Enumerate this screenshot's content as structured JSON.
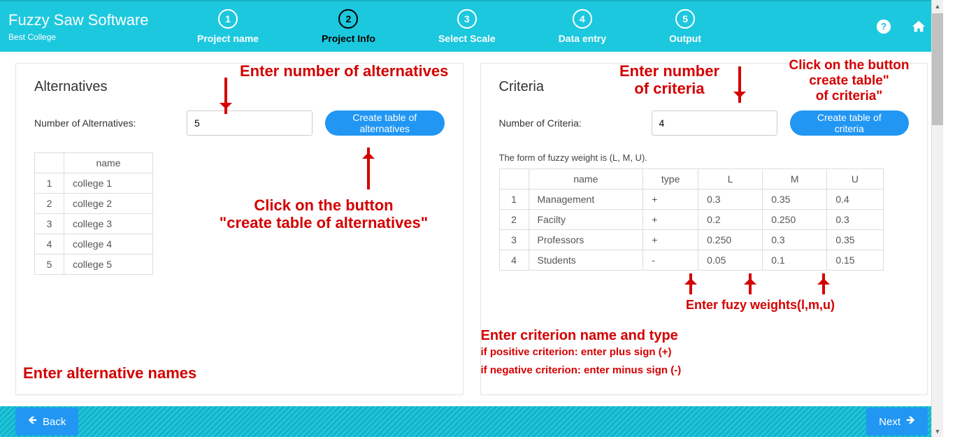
{
  "brand": {
    "title": "Fuzzy Saw Software",
    "subtitle": "Best College"
  },
  "steps": [
    {
      "num": "1",
      "label": "Project name"
    },
    {
      "num": "2",
      "label": "Project Info"
    },
    {
      "num": "3",
      "label": "Select Scale"
    },
    {
      "num": "4",
      "label": "Data entry"
    },
    {
      "num": "5",
      "label": "Output"
    }
  ],
  "alternatives": {
    "heading": "Alternatives",
    "field_label": "Number of Alternatives:",
    "field_value": "5",
    "button": "Create table of alternatives",
    "col_name": "name",
    "rows": [
      {
        "idx": "1",
        "name": "college 1"
      },
      {
        "idx": "2",
        "name": "college 2"
      },
      {
        "idx": "3",
        "name": "college 3"
      },
      {
        "idx": "4",
        "name": "college 4"
      },
      {
        "idx": "5",
        "name": "college 5"
      }
    ]
  },
  "criteria": {
    "heading": "Criteria",
    "field_label": "Number of Criteria:",
    "field_value": "4",
    "button": "Create table of criteria",
    "note": "The form of fuzzy weight is (L, M, U).",
    "cols": {
      "name": "name",
      "type": "type",
      "L": "L",
      "M": "M",
      "U": "U"
    },
    "rows": [
      {
        "idx": "1",
        "name": "Management",
        "type": "+",
        "L": "0.3",
        "M": "0.35",
        "U": "0.4"
      },
      {
        "idx": "2",
        "name": "Facilty",
        "type": "+",
        "L": "0.2",
        "M": "0.250",
        "U": "0.3"
      },
      {
        "idx": "3",
        "name": "Professors",
        "type": "+",
        "L": "0.250",
        "M": "0.3",
        "U": "0.35"
      },
      {
        "idx": "4",
        "name": "Students",
        "type": "-",
        "L": "0.05",
        "M": "0.1",
        "U": "0.15"
      }
    ]
  },
  "annotations": {
    "a1": "Enter number of alternatives",
    "a2": "Click on the button\n\"create table of alternatives\"",
    "a3": "Enter alternative names",
    "c1": "Enter number\nof criteria",
    "c2": "Click on the button\ncreate table\"\nof criteria\"",
    "c3": "Enter fuzy weights(l,m,u)",
    "c4a": "Enter criterion name and type",
    "c4b": "if positive criterion: enter plus sign (+)",
    "c4c": "if negative criterion: enter minus sign (-)"
  },
  "footer": {
    "back": "Back",
    "next": "Next"
  }
}
